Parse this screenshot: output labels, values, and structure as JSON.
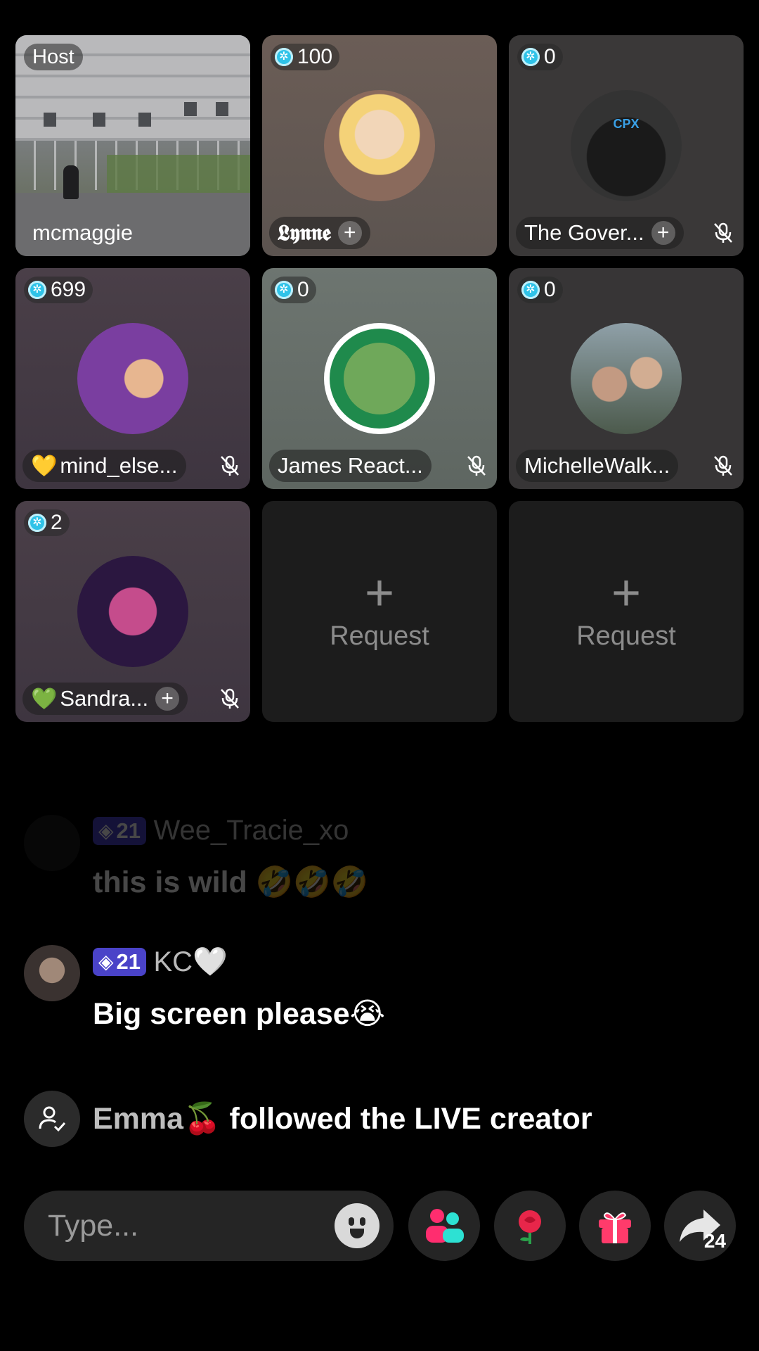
{
  "guests": [
    {
      "badge": "Host",
      "name": "mcmaggie"
    },
    {
      "coins": "100",
      "name": "𝕷𝖞𝖓𝖓𝖊"
    },
    {
      "coins": "0",
      "name": "The Gover..."
    },
    {
      "coins": "699",
      "heart": "💛",
      "name": "mind_else..."
    },
    {
      "coins": "0",
      "name": "James React..."
    },
    {
      "coins": "0",
      "name": "MichelleWalk..."
    },
    {
      "coins": "2",
      "heart": "💚",
      "name": "Sandra..."
    }
  ],
  "request_slots": [
    {
      "plus": "+",
      "label": "Request"
    },
    {
      "plus": "+",
      "label": "Request"
    }
  ],
  "comments": [
    {
      "level": "21",
      "user": "Wee_Tracie_xo",
      "text": "this is wild 🤣🤣🤣"
    },
    {
      "level": "21",
      "user": "KC🤍",
      "text": "Big screen please😭"
    }
  ],
  "follow_event": {
    "user": "Emma🍒",
    "text": " followed the LIVE creator"
  },
  "composer": {
    "placeholder": "Type..."
  },
  "share": {
    "count": "24"
  },
  "icons": {
    "mute": "microphone-muted-icon",
    "plus": "plus-icon",
    "emoji": "emoji-smile-icon",
    "guests": "multi-guest-icon",
    "rose": "rose-icon",
    "gift": "gift-icon",
    "share": "share-arrow-icon",
    "follow": "user-check-icon"
  }
}
